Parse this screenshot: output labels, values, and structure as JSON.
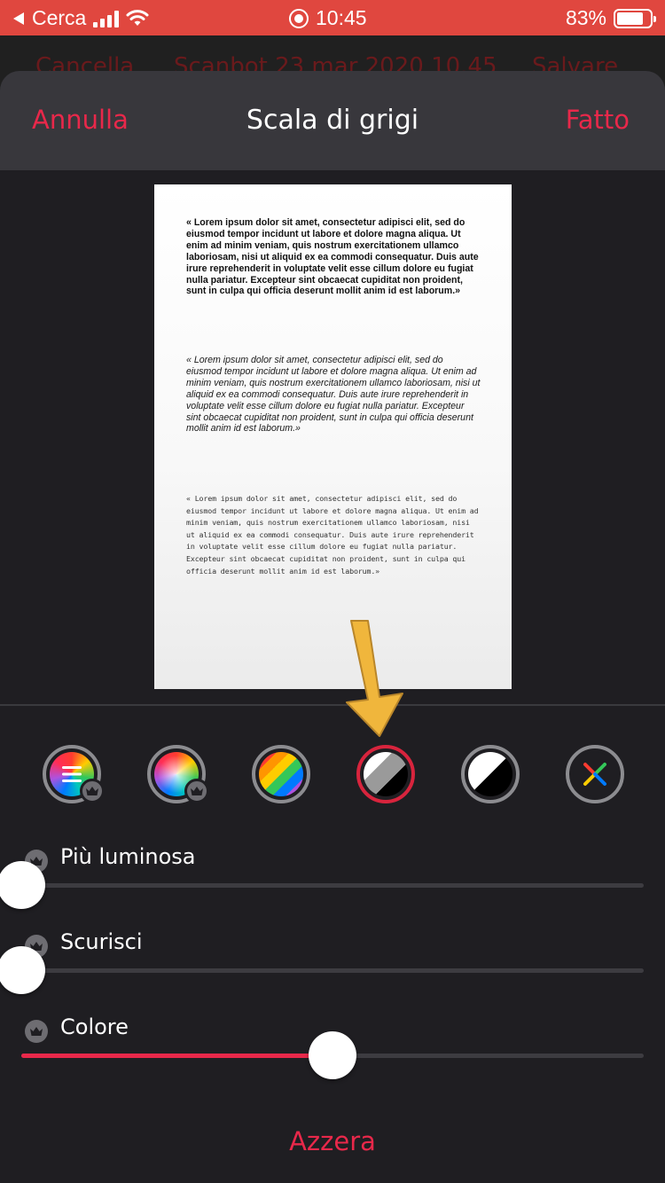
{
  "status_bar": {
    "back_label": "Cerca",
    "time": "10:45",
    "battery": "83%",
    "battery_level": 0.83,
    "color": "#e0473f"
  },
  "background_header": {
    "left": "Cancella",
    "title": "Scanbot 23 mar 2020 10.45",
    "right": "Salvare"
  },
  "nav": {
    "cancel_label": "Annulla",
    "title": "Scala di grigi",
    "done_label": "Fatto"
  },
  "document": {
    "paragraphs": [
      "« Lorem ipsum dolor sit amet, consectetur adipisci elit, sed do eiusmod tempor incidunt ut labore et dolore magna aliqua. Ut enim ad minim veniam, quis nostrum exercitationem ullamco laboriosam, nisi ut aliquid ex ea commodi consequatur. Duis aute irure reprehenderit in voluptate velit esse cillum dolore eu fugiat nulla pariatur. Excepteur sint obcaecat cupiditat non proident, sunt in culpa qui officia deserunt mollit anim id est laborum.»",
      "« Lorem ipsum dolor sit amet, consectetur adipisci elit, sed do eiusmod tempor incidunt ut labore et dolore magna aliqua. Ut enim ad minim veniam, quis nostrum exercitationem ullamco laboriosam, nisi ut aliquid ex ea commodi consequatur. Duis aute irure reprehenderit in voluptate velit esse cillum dolore eu fugiat nulla pariatur. Excepteur sint obcaecat cupiditat non proident, sunt in culpa qui officia deserunt mollit anim id est laborum.»",
      "« Lorem ipsum dolor sit amet, consectetur adipisci elit, sed do eiusmod tempor incidunt ut labore et dolore magna aliqua. Ut enim ad minim veniam, quis nostrum exercitationem ullamco laboriosam, nisi ut aliquid ex ea commodi consequatur. Duis aute irure reprehenderit in voluptate velit esse cillum dolore eu fugiat nulla pariatur. Excepteur sint obcaecat cupiditat non proident, sunt in culpa qui officia deserunt mollit anim id est laborum.»"
    ]
  },
  "filters": [
    {
      "icon": "magic-color-filter-icon",
      "premium": true
    },
    {
      "icon": "color-wheel-filter-icon",
      "premium": true
    },
    {
      "icon": "rainbow-filter-icon",
      "premium": false
    },
    {
      "icon": "grayscale-filter-icon",
      "premium": false,
      "selected": true
    },
    {
      "icon": "black-white-filter-icon",
      "premium": false
    },
    {
      "icon": "no-filter-icon",
      "premium": false
    }
  ],
  "sliders": [
    {
      "label": "Più luminosa",
      "value": 0.0
    },
    {
      "label": "Scurisci",
      "value": 0.0
    },
    {
      "label": "Colore",
      "value": 0.5
    }
  ],
  "reset_label": "Azzera",
  "accent_color": "#e8284a",
  "annotation_arrow_color": "#f0b63c"
}
